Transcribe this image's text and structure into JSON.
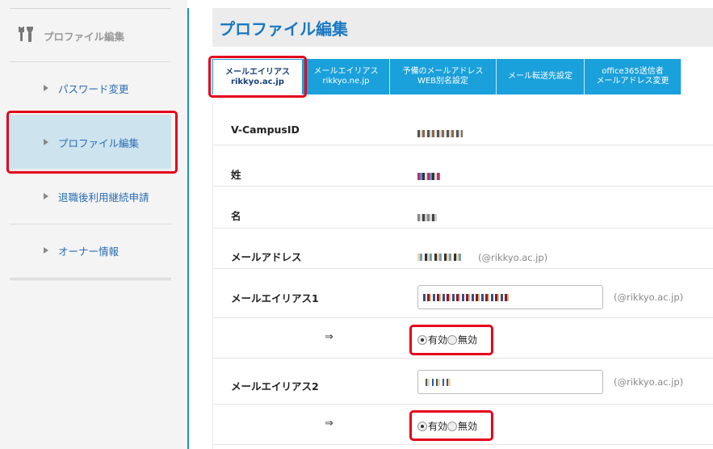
{
  "sidebar": {
    "header_label": "プロファイル編集",
    "items": [
      {
        "label": "パスワード変更"
      },
      {
        "label": "プロファイル編集"
      },
      {
        "label": "退職後利用継続申請"
      },
      {
        "label": "オーナー情報"
      }
    ]
  },
  "main": {
    "title": "プロファイル編集",
    "tabs": [
      {
        "line1": "メールエイリアス",
        "line2": "rikkyo.ac.jp"
      },
      {
        "line1": "メールエイリアス",
        "line2": "rikkyo.ne.jp"
      },
      {
        "line1": "予備のメールアドレス",
        "line2": "WEB別名設定"
      },
      {
        "line1": "メール転送先設定",
        "line2": ""
      },
      {
        "line1": "office365送信者",
        "line2": "メールアドレス変更"
      }
    ],
    "fields": {
      "vcampus_label": "V-CampusID",
      "sei_label": "姓",
      "mei_label": "名",
      "mail_label": "メールアドレス",
      "mail_domain": "(@rikkyo.ac.jp)",
      "alias1_label": "メールエイリアス1",
      "alias1_domain": "(@rikkyo.ac.jp)",
      "alias2_label": "メールエイリアス2",
      "alias2_domain": "(@rikkyo.ac.jp)",
      "arrow": "⇒",
      "enabled_label": "有効",
      "disabled_label": "無効"
    }
  },
  "colors": {
    "accent": "#1aa0da",
    "title": "#1a78c2",
    "highlight": "#e4001b",
    "active_bg": "#cde3ee"
  }
}
